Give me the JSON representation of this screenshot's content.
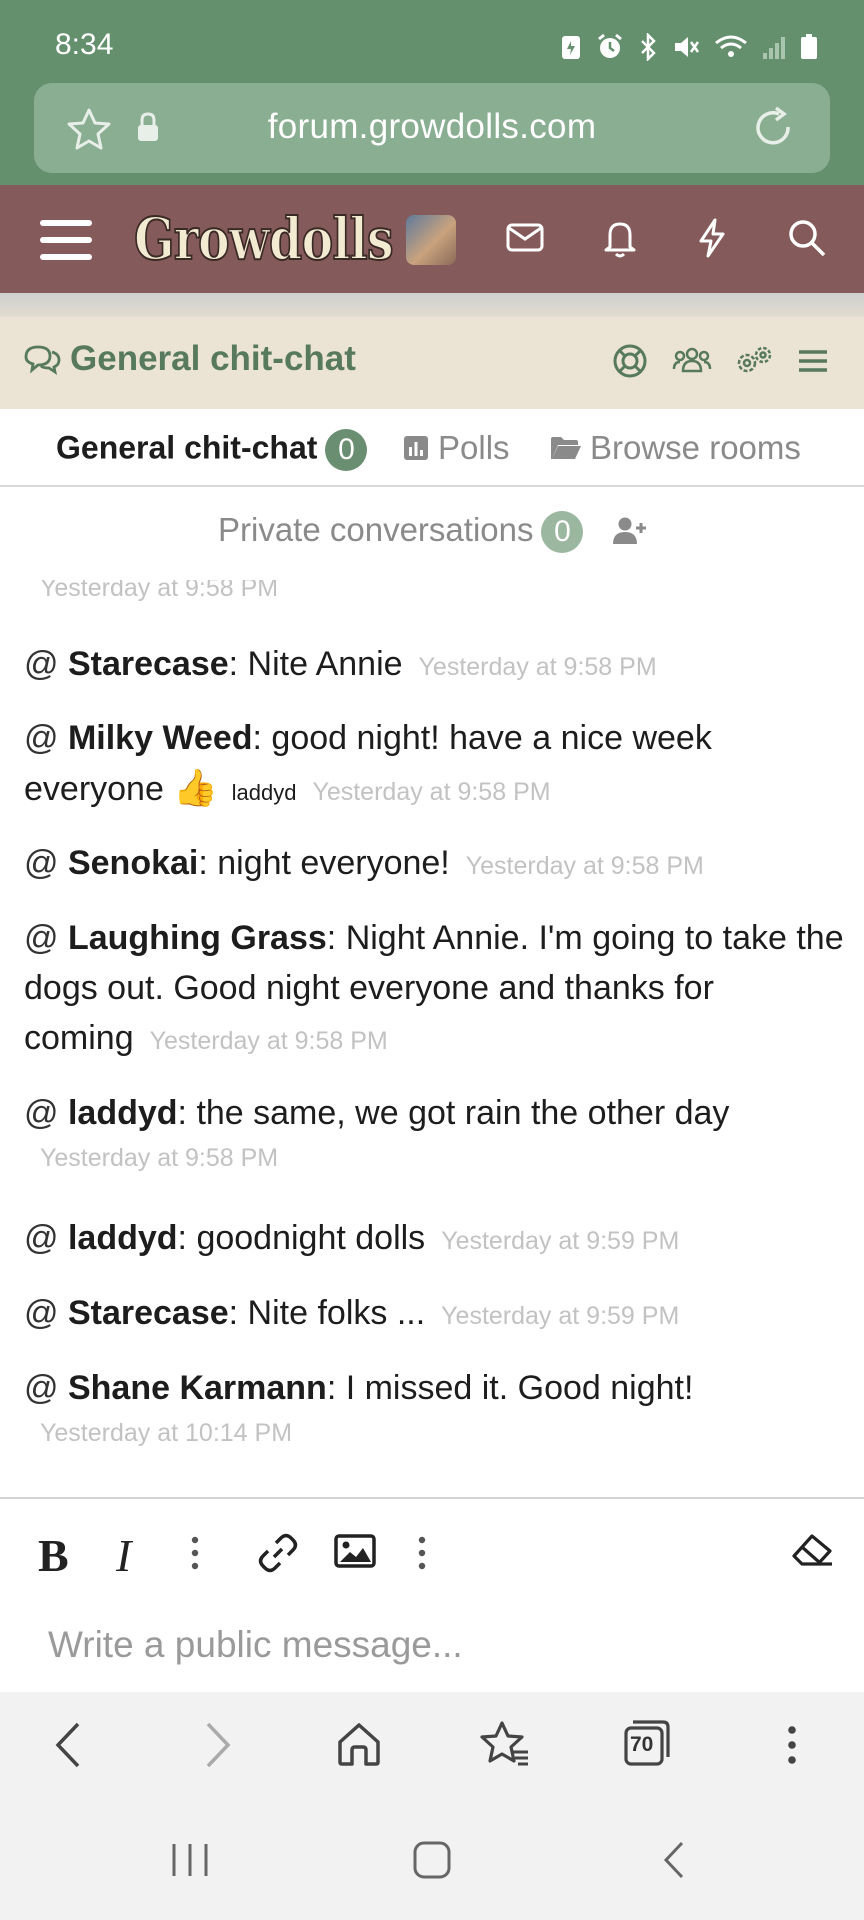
{
  "status_bar": {
    "time": "8:34"
  },
  "browser": {
    "url": "forum.growdolls.com"
  },
  "site": {
    "logo": "Growdolls"
  },
  "chat": {
    "title": "General chit-chat",
    "tabs": {
      "active": {
        "label": "General chit-chat",
        "count": "0"
      },
      "polls": "Polls",
      "browse_rooms": "Browse rooms",
      "private": {
        "label": "Private conversations",
        "count": "0"
      }
    },
    "top_partial_timestamp": "Yesterday at 9:58 PM",
    "messages": [
      {
        "at": "@",
        "user": "Starecase",
        "text": ": Nite Annie",
        "timestamp": "Yesterday at 9:58 PM"
      },
      {
        "at": "@",
        "user": "Milky Weed",
        "text": ": good night! have a nice week everyone",
        "emoji": "👍",
        "mention": "laddyd",
        "timestamp": "Yesterday at 9:58 PM"
      },
      {
        "at": "@",
        "user": "Senokai",
        "text": ": night everyone!",
        "timestamp": "Yesterday at 9:58 PM"
      },
      {
        "at": "@",
        "user": "Laughing Grass",
        "text": ": Night Annie. I'm going to take the dogs out. Good night everyone and thanks for coming",
        "timestamp": "Yesterday at 9:58 PM"
      },
      {
        "at": "@",
        "user": "laddyd",
        "text": ": the same, we got rain the other day",
        "timestamp": "Yesterday at 9:58 PM"
      },
      {
        "at": "@",
        "user": "laddyd",
        "text": ": goodnight dolls",
        "timestamp": "Yesterday at 9:59 PM"
      },
      {
        "at": "@",
        "user": "Starecase",
        "text": ": Nite folks ...",
        "timestamp": "Yesterday at 9:59 PM"
      },
      {
        "at": "@",
        "user": "Shane Karmann",
        "text": ": I missed it. Good night!",
        "timestamp": "Yesterday at 10:14 PM"
      }
    ],
    "composer": {
      "bold": "B",
      "italic": "I",
      "placeholder": "Write a public message..."
    }
  },
  "browser_toolbar": {
    "tab_count": "70"
  },
  "colors": {
    "status_green": "#64906e",
    "header_maroon": "#845a5a",
    "chat_title_bg": "#ebe3d3",
    "accent_green": "#57795e"
  }
}
